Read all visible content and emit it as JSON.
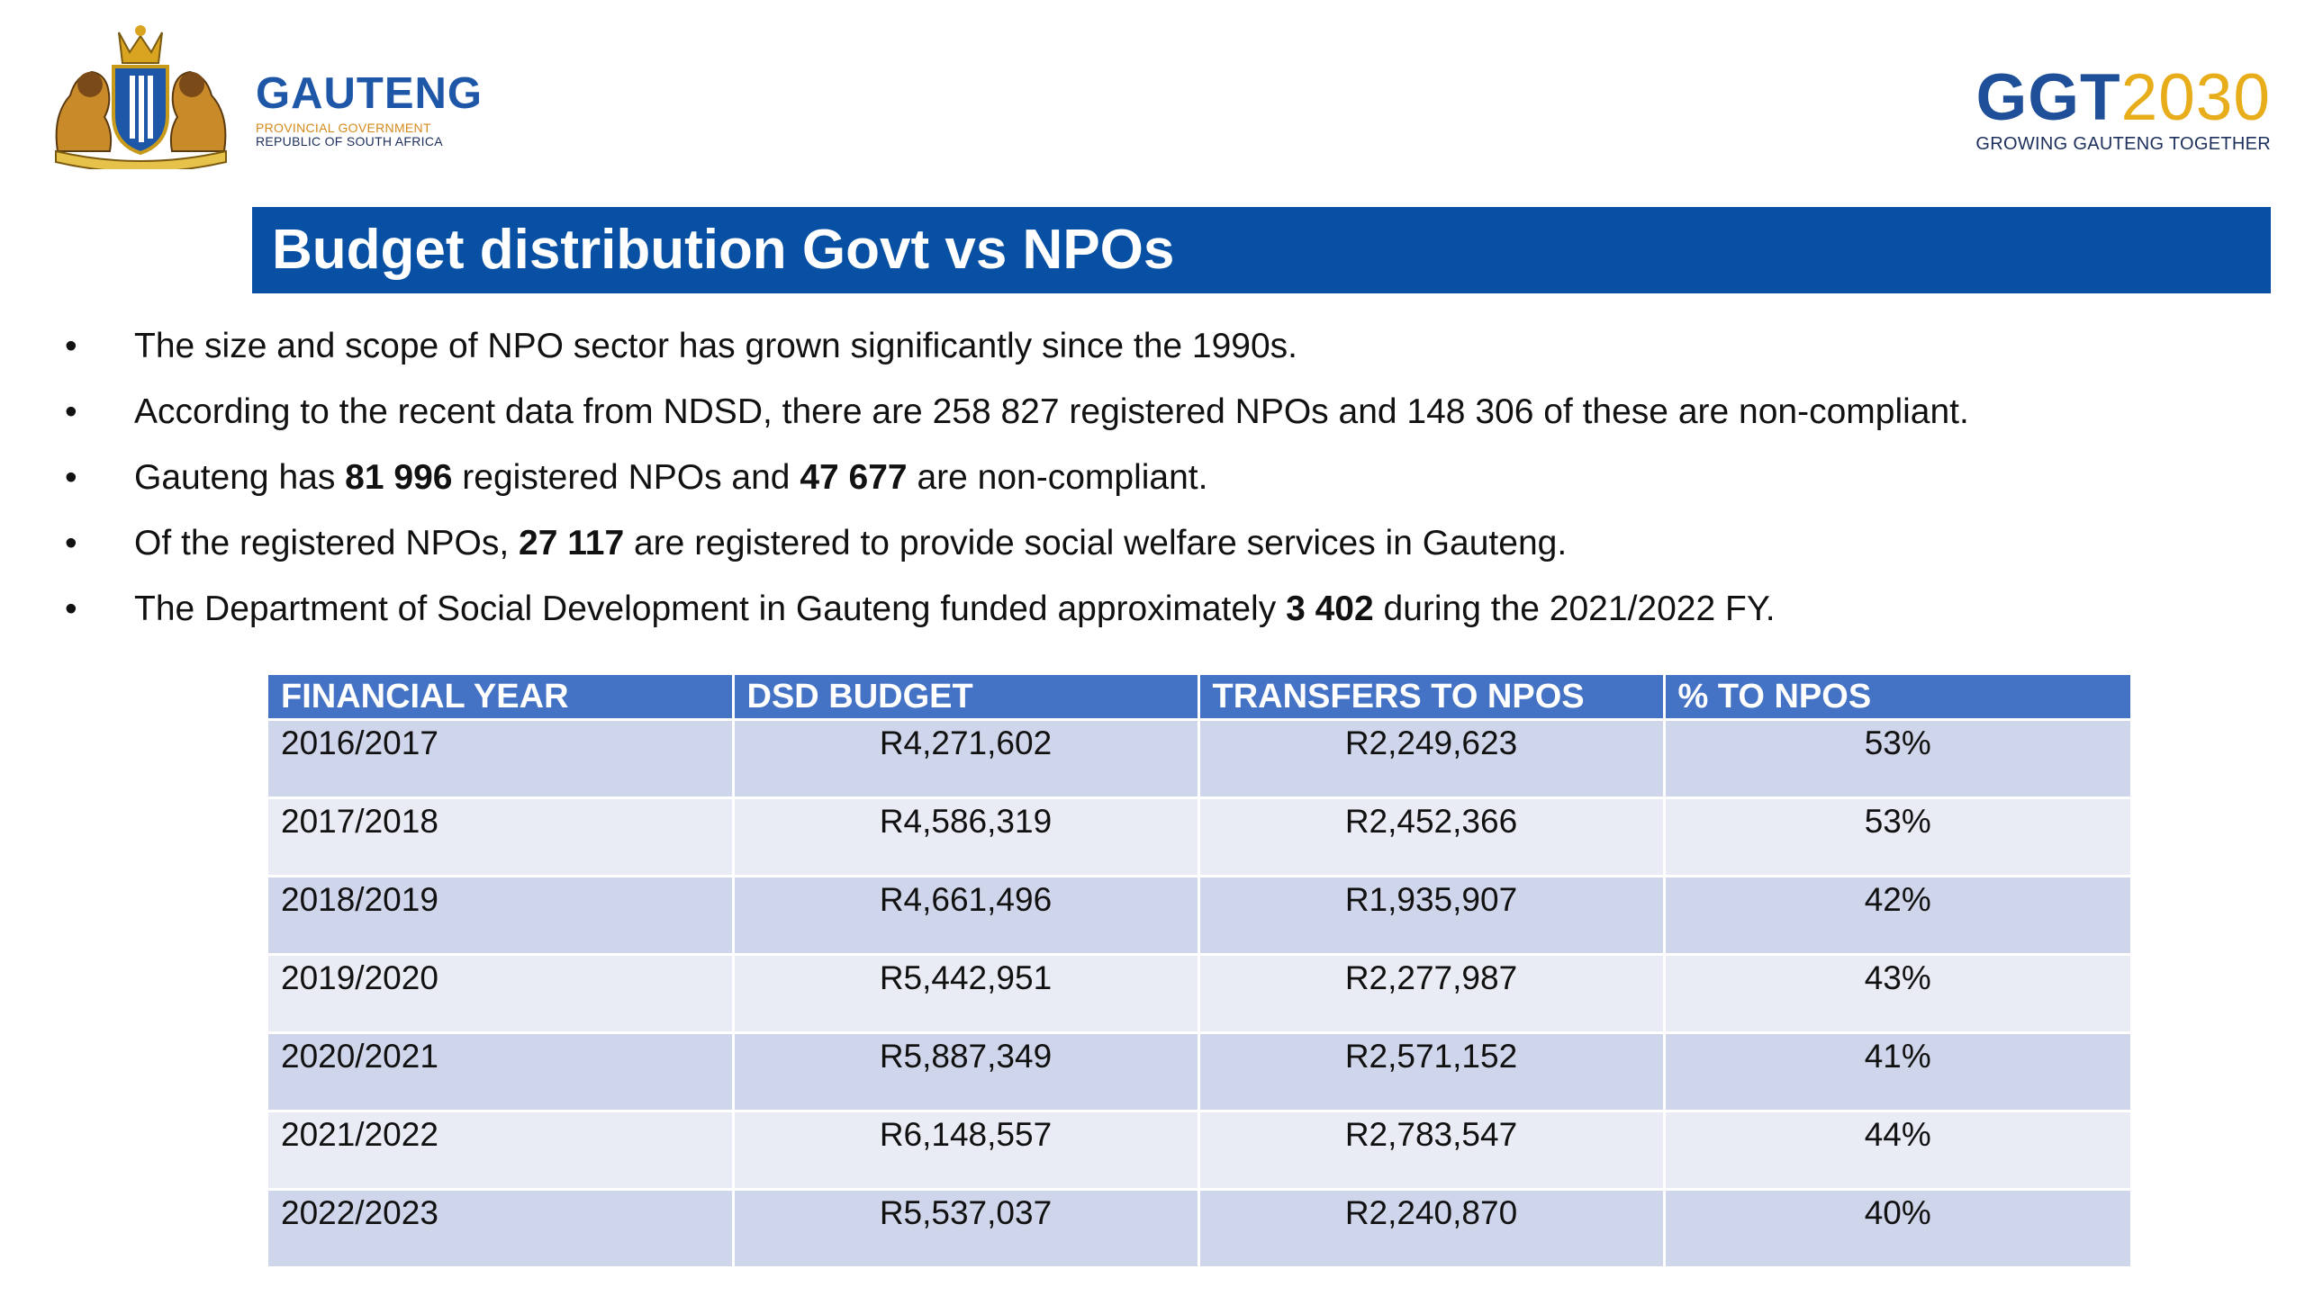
{
  "header": {
    "gov_logo": {
      "name": "GAUTENG",
      "sub1": "PROVINCIAL GOVERNMENT",
      "sub2": "REPUBLIC OF SOUTH AFRICA",
      "icon": "coat-of-arms-icon"
    },
    "ggt_logo": {
      "main_a": "GGT",
      "main_b": "2030",
      "tagline": "GROWING GAUTENG TOGETHER"
    }
  },
  "title": "Budget distribution Govt vs NPOs",
  "bullets": [
    {
      "parts": [
        {
          "t": "The size and scope of NPO sector has grown significantly since the 1990s."
        }
      ]
    },
    {
      "parts": [
        {
          "t": "According to the recent data from NDSD, there are 258 827 registered NPOs and 148 306 of these are non-compliant."
        }
      ]
    },
    {
      "parts": [
        {
          "t": "Gauteng has "
        },
        {
          "t": "81 996",
          "b": true
        },
        {
          "t": " registered NPOs and "
        },
        {
          "t": "47 677",
          "b": true
        },
        {
          "t": " are non-compliant."
        }
      ]
    },
    {
      "parts": [
        {
          "t": "Of the registered NPOs, "
        },
        {
          "t": "27 117",
          "b": true
        },
        {
          "t": " are registered to provide social welfare services in Gauteng."
        }
      ]
    },
    {
      "parts": [
        {
          "t": "The Department of Social Development in Gauteng funded approximately "
        },
        {
          "t": "3 402",
          "b": true
        },
        {
          "t": " during the 2021/2022 FY."
        }
      ]
    }
  ],
  "bullet_symbol": "•",
  "table": {
    "headers": [
      "FINANCIAL YEAR",
      "DSD BUDGET",
      "TRANSFERS TO NPOS",
      "% TO NPOS"
    ],
    "rows": [
      [
        "2016/2017",
        "R4,271,602",
        "R2,249,623",
        "53%"
      ],
      [
        "2017/2018",
        "R4,586,319",
        "R2,452,366",
        "53%"
      ],
      [
        "2018/2019",
        "R4,661,496",
        "R1,935,907",
        "42%"
      ],
      [
        "2019/2020",
        "R5,442,951",
        "R2,277,987",
        "43%"
      ],
      [
        "2020/2021",
        "R5,887,349",
        "R2,571,152",
        "41%"
      ],
      [
        "2021/2022",
        "R6,148,557",
        "R2,783,547",
        "44%"
      ],
      [
        "2022/2023",
        "R5,537,037",
        "R2,240,870",
        "40%"
      ]
    ]
  },
  "colors": {
    "title_bar": "#0750a3",
    "table_header": "#4472c4",
    "row_dark": "#cfd5ea",
    "row_light": "#e9ebf5"
  }
}
